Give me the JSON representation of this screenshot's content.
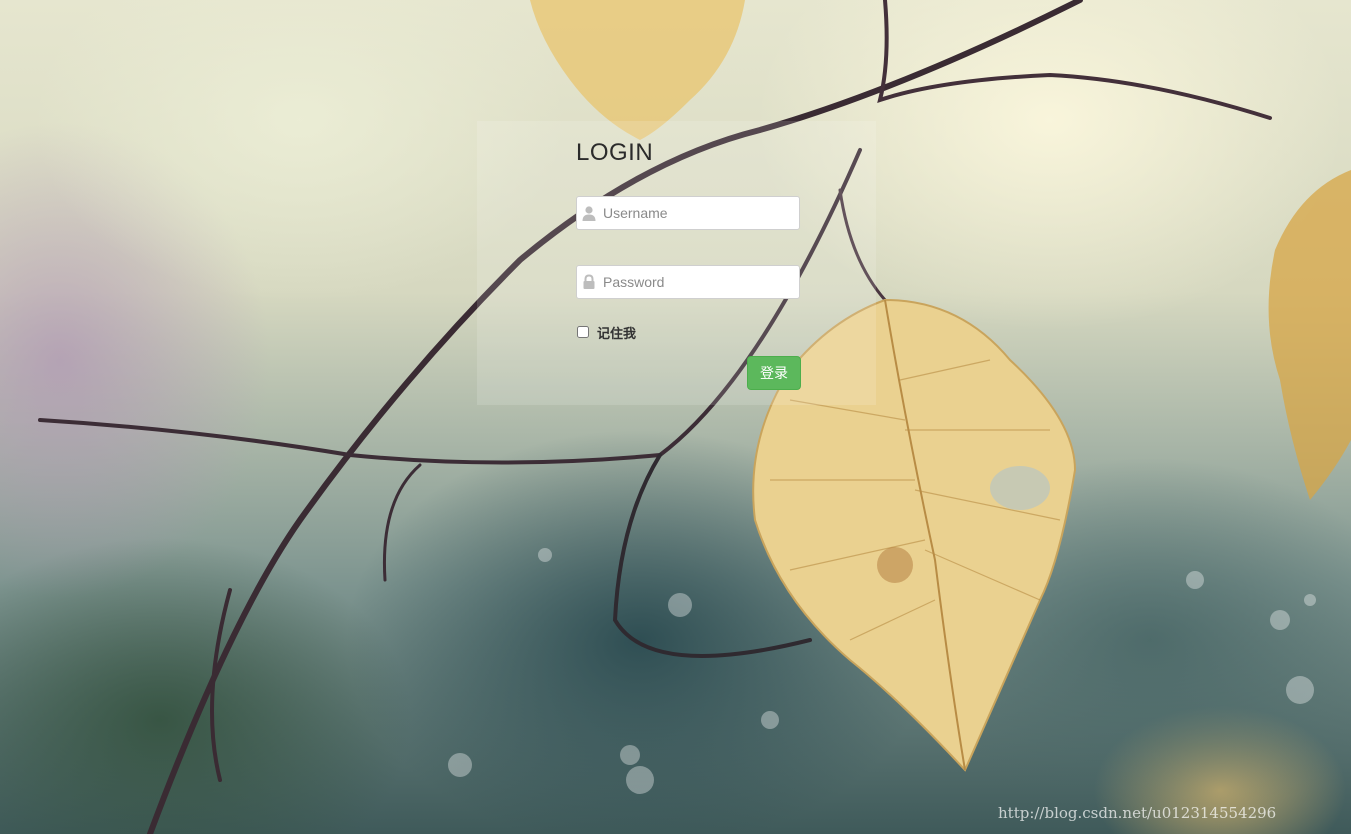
{
  "login": {
    "title": "LOGIN",
    "username": {
      "placeholder": "Username",
      "value": "",
      "icon": "user-icon"
    },
    "password": {
      "placeholder": "Password",
      "value": "",
      "icon": "lock-icon"
    },
    "remember_label": "记住我",
    "remember_checked": false,
    "submit_label": "登录"
  },
  "colors": {
    "button_bg": "#5cb85c",
    "button_border": "#4cae4c",
    "title_text": "#2b2b2b"
  },
  "watermark": "http://blog.csdn.net/u012314554296"
}
